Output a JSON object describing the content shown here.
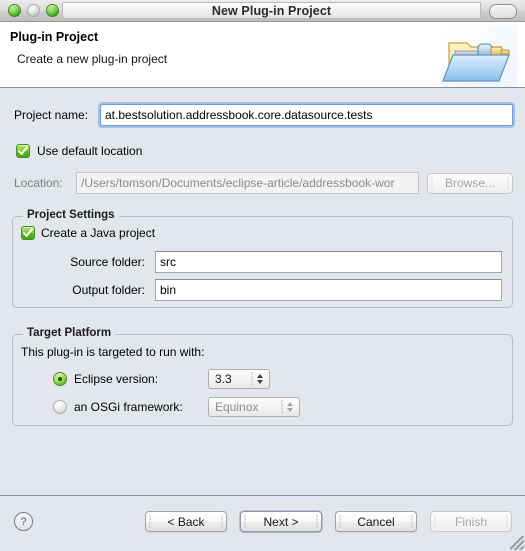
{
  "window": {
    "title": "New Plug-in Project",
    "traffic_lights": [
      "close-green",
      "minimize-disabled",
      "zoom-green"
    ],
    "toolbar_toggle": "toolbar-toggle-pill"
  },
  "header": {
    "title": "Plug-in Project",
    "subtitle": "Create a new plug-in project",
    "icon": "plugin-project-folder-icon"
  },
  "form": {
    "project_name": {
      "label": "Project name:",
      "value": "at.bestsolution.addressbook.core.datasource.tests",
      "focused": true
    },
    "use_default_location": {
      "label": "Use default location",
      "checked": true
    },
    "location": {
      "label": "Location:",
      "value": "/Users/tomson/Documents/eclipse-article/addressbook-wor",
      "disabled": true
    },
    "browse_button": {
      "label": "Browse...",
      "disabled": true
    }
  },
  "project_settings": {
    "title": "Project Settings",
    "create_java_project": {
      "label": "Create a Java project",
      "checked": true
    },
    "source_folder": {
      "label": "Source folder:",
      "value": "src"
    },
    "output_folder": {
      "label": "Output folder:",
      "value": "bin"
    }
  },
  "target_platform": {
    "title": "Target Platform",
    "description": "This plug-in is targeted to run with:",
    "eclipse_version": {
      "label": "Eclipse version:",
      "selected": true,
      "value": "3.3"
    },
    "osgi_framework": {
      "label": "an OSGi framework:",
      "selected": false,
      "value": "Equinox"
    }
  },
  "footer": {
    "help": "?",
    "back": "< Back",
    "next": "Next >",
    "cancel": "Cancel",
    "finish": "Finish",
    "finish_disabled": true,
    "default_button": "Next >"
  },
  "colors": {
    "dialog_bg": "#e3e7ed",
    "header_bg": "#ffffff",
    "accent_green": "#6cc22a",
    "focus_ring": "#70a5de",
    "separator": "#8a8f96"
  }
}
